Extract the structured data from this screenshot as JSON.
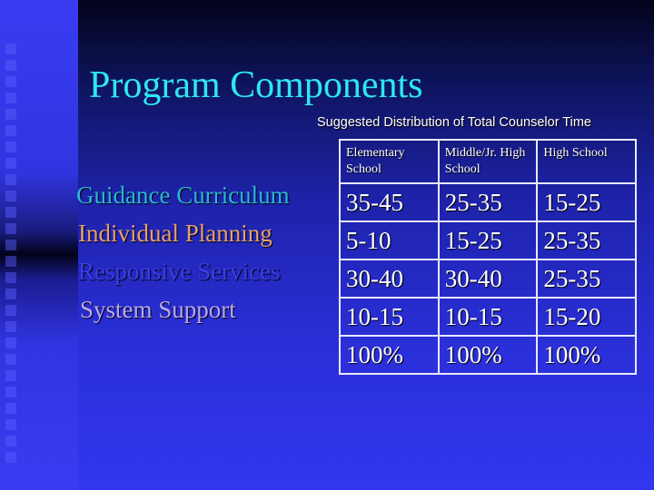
{
  "slide": {
    "title": "Program Components",
    "subtitle": "Suggested Distribution of Total Counselor Time",
    "components": [
      {
        "label": "Guidance Curriculum",
        "color": "#2ab8d8"
      },
      {
        "label": "Individual Planning",
        "color": "#e8a070"
      },
      {
        "label": "Responsive Services",
        "color": "#3a3ee8"
      },
      {
        "label": "System Support",
        "color": "#b8a8f0"
      }
    ],
    "table": {
      "headers": [
        "Elementary School",
        "Middle/Jr. High School",
        "High School"
      ],
      "rows": [
        [
          "35-45",
          "25-35",
          "15-25"
        ],
        [
          "5-10",
          "15-25",
          "25-35"
        ],
        [
          "30-40",
          "30-40",
          "25-35"
        ],
        [
          "10-15",
          "10-15",
          "15-20"
        ],
        [
          "100%",
          "100%",
          "100%"
        ]
      ]
    }
  }
}
